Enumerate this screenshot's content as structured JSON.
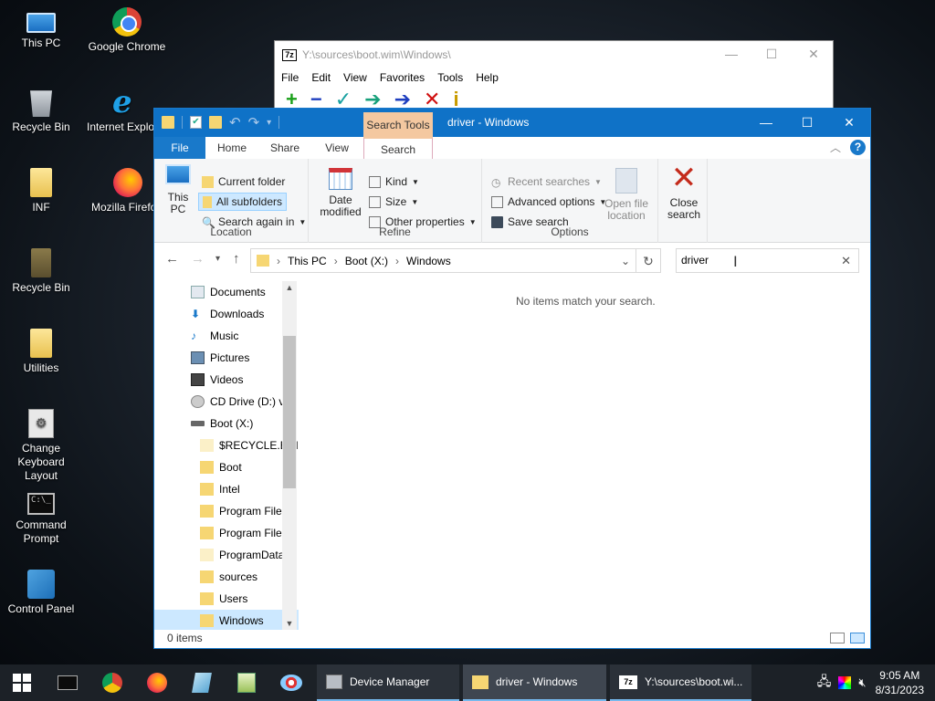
{
  "desktop": {
    "icons": [
      {
        "label": "This PC"
      },
      {
        "label": "Google Chrome"
      },
      {
        "label": "Recycle Bin"
      },
      {
        "label": "Internet Explorer"
      },
      {
        "label": "INF"
      },
      {
        "label": "Mozilla Firefox"
      },
      {
        "label": "Recycle Bin"
      },
      {
        "label": "Utilities"
      },
      {
        "label": "Change Keyboard Layout"
      },
      {
        "label": "Command Prompt"
      },
      {
        "label": "Control Panel"
      }
    ]
  },
  "sevenzip": {
    "title": "Y:\\sources\\boot.wim\\Windows\\",
    "logo": "7z",
    "menu": [
      "File",
      "Edit",
      "View",
      "Favorites",
      "Tools",
      "Help"
    ],
    "tools": [
      "+",
      "−",
      "✓",
      "➔",
      "➔",
      "✕",
      "i"
    ]
  },
  "explorer": {
    "title": "driver - Windows",
    "context_tab": "Search Tools",
    "tabs": [
      "File",
      "Home",
      "Share",
      "View",
      "Search"
    ],
    "ribbon": {
      "location": {
        "label": "Location",
        "this_pc": "This PC",
        "current_folder": "Current folder",
        "all_subfolders": "All subfolders",
        "search_again": "Search again in"
      },
      "refine": {
        "label": "Refine",
        "date_modified": "Date modified",
        "kind": "Kind",
        "size": "Size",
        "other_properties": "Other properties"
      },
      "options": {
        "label": "Options",
        "recent_searches": "Recent searches",
        "advanced_options": "Advanced options",
        "save_search": "Save search",
        "open_file_location": "Open file location"
      },
      "close": {
        "label": "Close search"
      }
    },
    "breadcrumb": [
      "This PC",
      "Boot (X:)",
      "Windows"
    ],
    "search_value": "driver",
    "nav": [
      "Documents",
      "Downloads",
      "Music",
      "Pictures",
      "Videos",
      "CD Drive (D:) v",
      "Boot (X:)",
      "$RECYCLE.BIN",
      "Boot",
      "Intel",
      "Program Files",
      "Program Files",
      "ProgramData",
      "sources",
      "Users",
      "Windows"
    ],
    "empty_message": "No items match your search.",
    "status": "0 items"
  },
  "taskbar": {
    "buttons": [
      {
        "label": "Device Manager"
      },
      {
        "label": "driver - Windows"
      },
      {
        "label": "Y:\\sources\\boot.wi..."
      }
    ],
    "time": "9:05 AM",
    "date": "8/31/2023"
  }
}
